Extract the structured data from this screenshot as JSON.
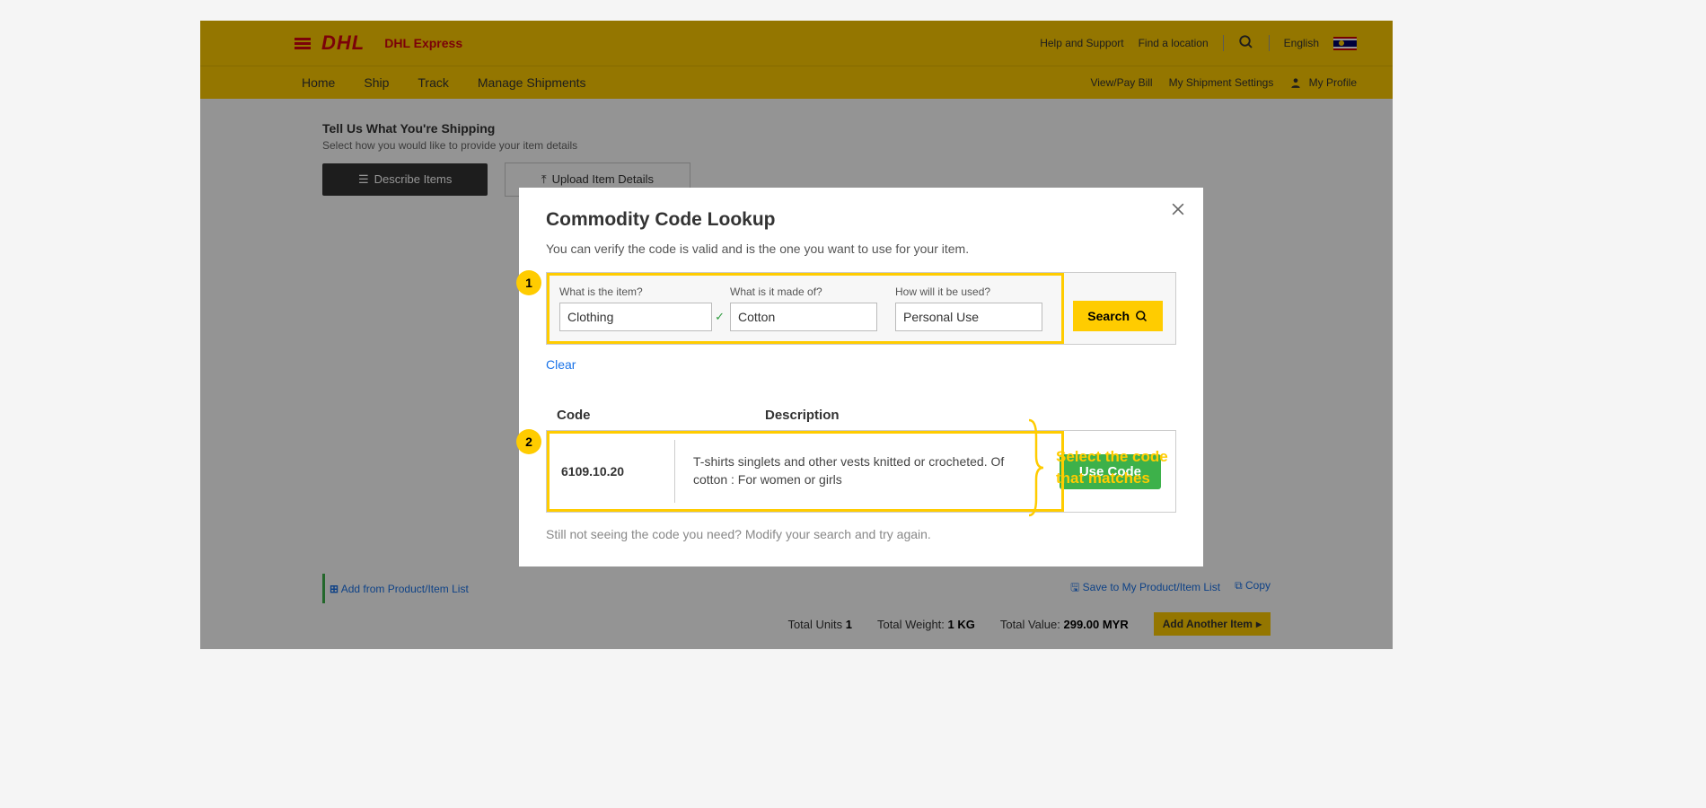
{
  "topbar": {
    "brand": "DHL",
    "brand_sub": "DHL Express",
    "help": "Help and Support",
    "find": "Find a location",
    "language": "English"
  },
  "nav": {
    "home": "Home",
    "ship": "Ship",
    "track": "Track",
    "manage": "Manage Shipments",
    "viewpay": "View/Pay Bill",
    "settings": "My Shipment Settings",
    "profile": "My Profile"
  },
  "page": {
    "section_title": "Tell Us What You're Shipping",
    "section_sub": "Select how you would like to provide your item details",
    "tab_describe": "Describe Items",
    "tab_upload": "Upload Item Details",
    "add_from_list": "Add from Product/Item List",
    "save_to_list": "Save to My Product/Item List",
    "copy": "Copy",
    "totals": {
      "units_label": "Total Units",
      "units": "1",
      "weight_label": "Total Weight:",
      "weight": "1 KG",
      "value_label": "Total Value:",
      "value": "299.00 MYR"
    },
    "add_another": "Add Another Item"
  },
  "modal": {
    "title": "Commodity Code Lookup",
    "subtitle": "You can verify the code is valid and is the one you want to use for your item.",
    "badge1": "1",
    "badge2": "2",
    "fields": {
      "item_label": "What is the item?",
      "item_value": "Clothing",
      "made_label": "What is it made of?",
      "made_value": "Cotton",
      "used_label": "How will it be used?",
      "used_value": "Personal Use"
    },
    "search_btn": "Search",
    "clear": "Clear",
    "headers": {
      "code": "Code",
      "desc": "Description"
    },
    "result": {
      "code": "6109.10.20",
      "description": "T-shirts singlets and other vests knitted or crocheted. Of cotton : For women or girls",
      "use_btn": "Use Code"
    },
    "not_seeing": "Still not seeing the code you need? Modify your search and try again."
  },
  "annotation": {
    "line1": "Select the code",
    "line2": "that matches"
  }
}
